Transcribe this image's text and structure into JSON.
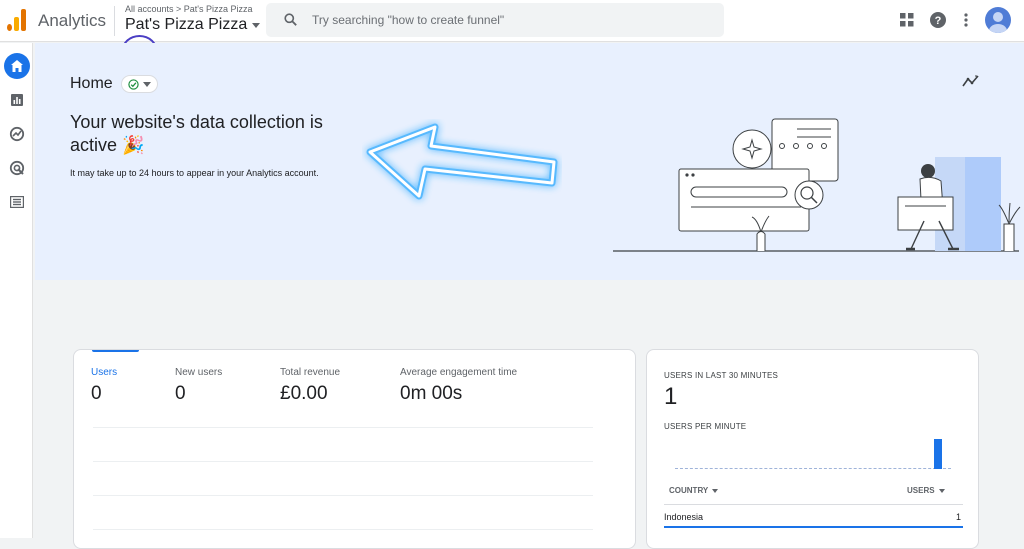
{
  "app": {
    "name": "Analytics"
  },
  "account": {
    "breadcrumb": "All accounts > Pat's Pizza Pizza",
    "property": "Pat's Pizza Pizza"
  },
  "search": {
    "placeholder": "Try searching \"how to create funnel\""
  },
  "icons": {
    "topbar": [
      "apps-icon",
      "help-icon",
      "more-vert-icon",
      "account-avatar"
    ],
    "sidenav": [
      "home-icon",
      "reports-icon",
      "explore-icon",
      "advertising-icon",
      "configure-icon"
    ]
  },
  "colors": {
    "accent": "#1a73e8",
    "hero_bg": "#e8f0fe",
    "logo": "#f9ab00",
    "annotation_arrow": "#1aa3ff",
    "click_ring": "#4b3fc4"
  },
  "home": {
    "title": "Home",
    "headline": "Your website's data collection is active 🎉",
    "subtext": "It may take up to 24 hours to appear in your Analytics account."
  },
  "metrics": [
    {
      "label": "Users",
      "value": "0"
    },
    {
      "label": "New users",
      "value": "0"
    },
    {
      "label": "Total revenue",
      "value": "£0.00"
    },
    {
      "label": "Average engagement time",
      "value": "0m 00s"
    }
  ],
  "realtime": {
    "title": "USERS IN LAST 30 MINUTES",
    "value": "1",
    "sub_title": "USERS PER MINUTE",
    "col_country": "COUNTRY",
    "col_users": "USERS",
    "rows": [
      {
        "country": "Indonesia",
        "users": "1"
      }
    ]
  }
}
